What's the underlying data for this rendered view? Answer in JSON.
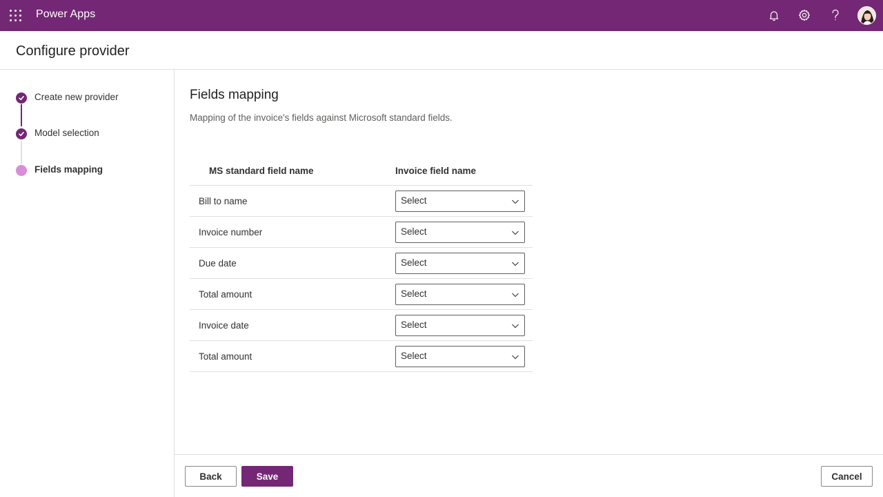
{
  "topbar": {
    "app_name": "Power Apps",
    "icons": [
      "waffle-icon",
      "bell-icon",
      "gear-icon",
      "help-icon",
      "avatar"
    ]
  },
  "header": {
    "title": "Configure provider"
  },
  "steps": [
    {
      "label": "Create new provider",
      "status": "complete"
    },
    {
      "label": "Model selection",
      "status": "complete"
    },
    {
      "label": "Fields mapping",
      "status": "current"
    }
  ],
  "main": {
    "title": "Fields mapping",
    "description": "Mapping of the invoice's fields against Microsoft standard fields.",
    "table": {
      "columns": [
        "MS standard field name",
        "Invoice field name"
      ],
      "rows": [
        {
          "field": "Bill to name",
          "value": "Select"
        },
        {
          "field": "Invoice number",
          "value": "Select"
        },
        {
          "field": "Due date",
          "value": "Select"
        },
        {
          "field": "Total amount",
          "value": "Select"
        },
        {
          "field": "Invoice date",
          "value": "Select"
        },
        {
          "field": "Total amount",
          "value": "Select"
        }
      ]
    }
  },
  "footer": {
    "back_label": "Back",
    "save_label": "Save",
    "cancel_label": "Cancel"
  },
  "colors": {
    "brand": "#742774",
    "step_current": "#d98ed9",
    "divider": "#e1dfdd"
  }
}
